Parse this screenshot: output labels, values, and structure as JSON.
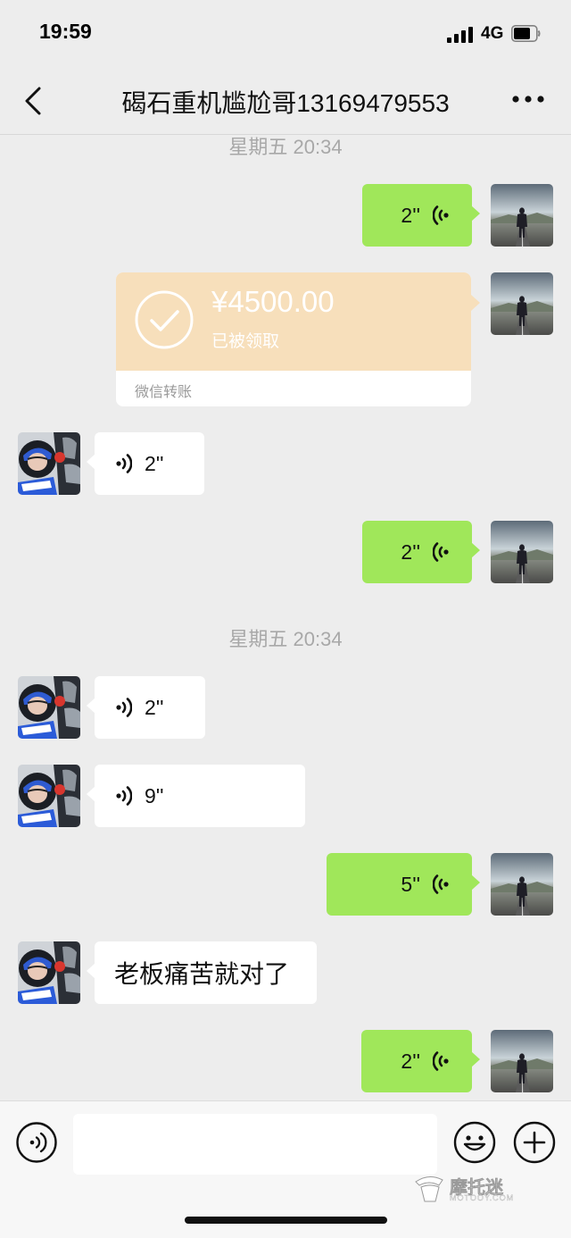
{
  "status_bar": {
    "time": "19:59",
    "network": "4G"
  },
  "header": {
    "title": "碣石重机尴尬哥13169479553"
  },
  "messages": {
    "time_label_1": "星期五 20:34",
    "time_label_2": "星期五 20:34",
    "m1": {
      "duration": "2''"
    },
    "transfer": {
      "amount": "¥4500.00",
      "status": "已被领取",
      "footer": "微信转账"
    },
    "m3": {
      "duration": "2''"
    },
    "m4": {
      "duration": "2''"
    },
    "m5": {
      "duration": "2''"
    },
    "m6": {
      "duration": "9''"
    },
    "m7": {
      "duration": "5''"
    },
    "m8": {
      "text": "老板痛苦就对了"
    },
    "m9": {
      "duration": "2''"
    }
  },
  "watermark": {
    "text": "摩托迷",
    "sub": "MOTOOY.COM"
  },
  "colors": {
    "sent_bubble": "#a0e75a",
    "transfer_card": "#f7dfbb",
    "background": "#ededed"
  }
}
